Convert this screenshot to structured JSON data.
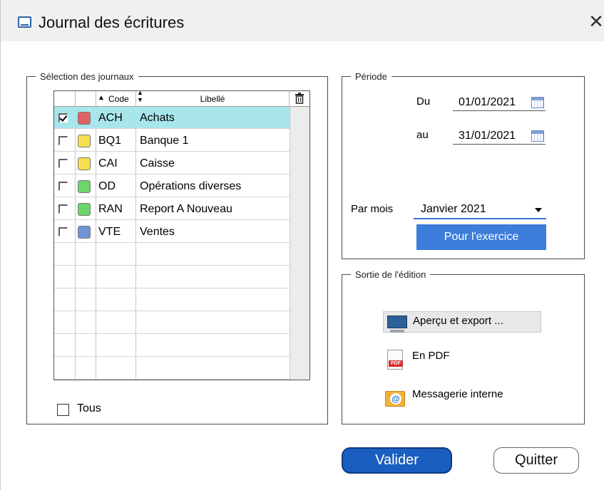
{
  "window": {
    "title": "Journal des écritures",
    "close_symbol": "✕"
  },
  "journals": {
    "legend": "Sélection des journaux",
    "columns": {
      "code": "Code",
      "label": "Libellé"
    },
    "rows": [
      {
        "checked": true,
        "color": "#e06464",
        "code": "ACH",
        "label": "Achats"
      },
      {
        "checked": false,
        "color": "#f5e04d",
        "code": "BQ1",
        "label": "Banque 1"
      },
      {
        "checked": false,
        "color": "#f5e04d",
        "code": "CAI",
        "label": "Caisse"
      },
      {
        "checked": false,
        "color": "#6cd66c",
        "code": "OD",
        "label": "Opérations diverses"
      },
      {
        "checked": false,
        "color": "#6cd66c",
        "code": "RAN",
        "label": "Report A Nouveau"
      },
      {
        "checked": false,
        "color": "#6f95d6",
        "code": "VTE",
        "label": "Ventes"
      }
    ],
    "all_label": "Tous",
    "all_checked": false
  },
  "period": {
    "legend": "Période",
    "from_label": "Du",
    "from_value": "01/01/2021",
    "to_label": "au",
    "to_value": "31/01/2021",
    "month_label": "Par mois",
    "month_value": "Janvier 2021",
    "exercise_button": "Pour l'exercice"
  },
  "output": {
    "legend": "Sortie de l'édition",
    "preview": "Aperçu et export ...",
    "pdf": "En PDF",
    "pdf_badge": "PDF",
    "messaging": "Messagerie interne",
    "messaging_badge": "@"
  },
  "actions": {
    "validate": "Valider",
    "quit": "Quitter"
  },
  "colors": {
    "selection_row": "#a9e6eb",
    "accent": "#3d7ddb",
    "validate_bg": "#1a5fc0"
  }
}
